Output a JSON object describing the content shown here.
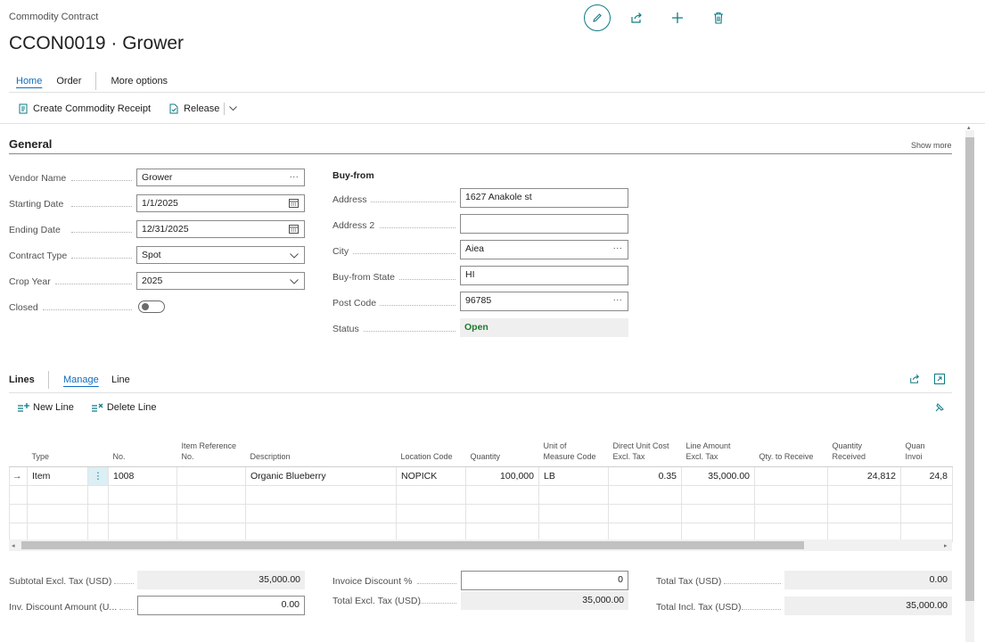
{
  "header": {
    "breadcrumb": "Commodity Contract",
    "title": "CCON0019 · Grower"
  },
  "tabs": [
    "Home",
    "Order",
    "More options"
  ],
  "actions": {
    "create_receipt": "Create Commodity Receipt",
    "release": "Release"
  },
  "general": {
    "title": "General",
    "show_more": "Show more",
    "vendor_name": {
      "label": "Vendor Name",
      "value": "Grower"
    },
    "starting_date": {
      "label": "Starting Date",
      "value": "1/1/2025"
    },
    "ending_date": {
      "label": "Ending Date",
      "value": "12/31/2025"
    },
    "contract_type": {
      "label": "Contract Type",
      "value": "Spot"
    },
    "crop_year": {
      "label": "Crop Year",
      "value": "2025"
    },
    "closed": {
      "label": "Closed",
      "value": false
    },
    "buy_from": {
      "title": "Buy-from",
      "address": {
        "label": "Address",
        "value": "1627 Anakole st"
      },
      "address2": {
        "label": "Address 2",
        "value": ""
      },
      "city": {
        "label": "City",
        "value": "Aiea"
      },
      "state": {
        "label": "Buy-from State",
        "value": "HI"
      },
      "post_code": {
        "label": "Post Code",
        "value": "96785"
      },
      "status": {
        "label": "Status",
        "value": "Open"
      }
    }
  },
  "lines": {
    "title": "Lines",
    "tabs": [
      "Manage",
      "Line"
    ],
    "new_line": "New Line",
    "delete_line": "Delete Line",
    "columns": {
      "type": "Type",
      "no": "No.",
      "item_ref_1": "Item Reference",
      "item_ref_2": "No.",
      "description": "Description",
      "location": "Location Code",
      "quantity": "Quantity",
      "uom_1": "Unit of",
      "uom_2": "Measure Code",
      "duc_1": "Direct Unit Cost",
      "duc_2": "Excl. Tax",
      "la_1": "Line Amount",
      "la_2": "Excl. Tax",
      "qty_receive": "Qty. to Receive",
      "qr_1": "Quantity",
      "qr_2": "Received",
      "qi_1": "Quan",
      "qi_2": "Invoi"
    },
    "row": {
      "type": "Item",
      "no": "1008",
      "item_ref": "",
      "description": "Organic Blueberry",
      "location": "NOPICK",
      "quantity": "100,000",
      "uom": "LB",
      "direct_unit_cost": "0.35",
      "line_amount": "35,000.00",
      "qty_to_receive": "",
      "qty_received": "24,812",
      "qty_invoiced": "24,8"
    }
  },
  "totals": {
    "subtotal": {
      "label": "Subtotal Excl. Tax (USD)",
      "value": "35,000.00"
    },
    "inv_disc_amount": {
      "label": "Inv. Discount Amount (U...",
      "value": "0.00"
    },
    "invoice_disc_pct": {
      "label": "Invoice Discount %",
      "value": "0"
    },
    "total_excl": {
      "label": "Total Excl. Tax (USD)",
      "value": "35,000.00"
    },
    "total_tax": {
      "label": "Total Tax (USD)",
      "value": "0.00"
    },
    "total_incl": {
      "label": "Total Incl. Tax (USD)",
      "value": "35,000.00"
    }
  },
  "colors": {
    "accent": "#0f6cbd",
    "teal": "#0f7b84",
    "status_open": "#1e7a2a"
  }
}
